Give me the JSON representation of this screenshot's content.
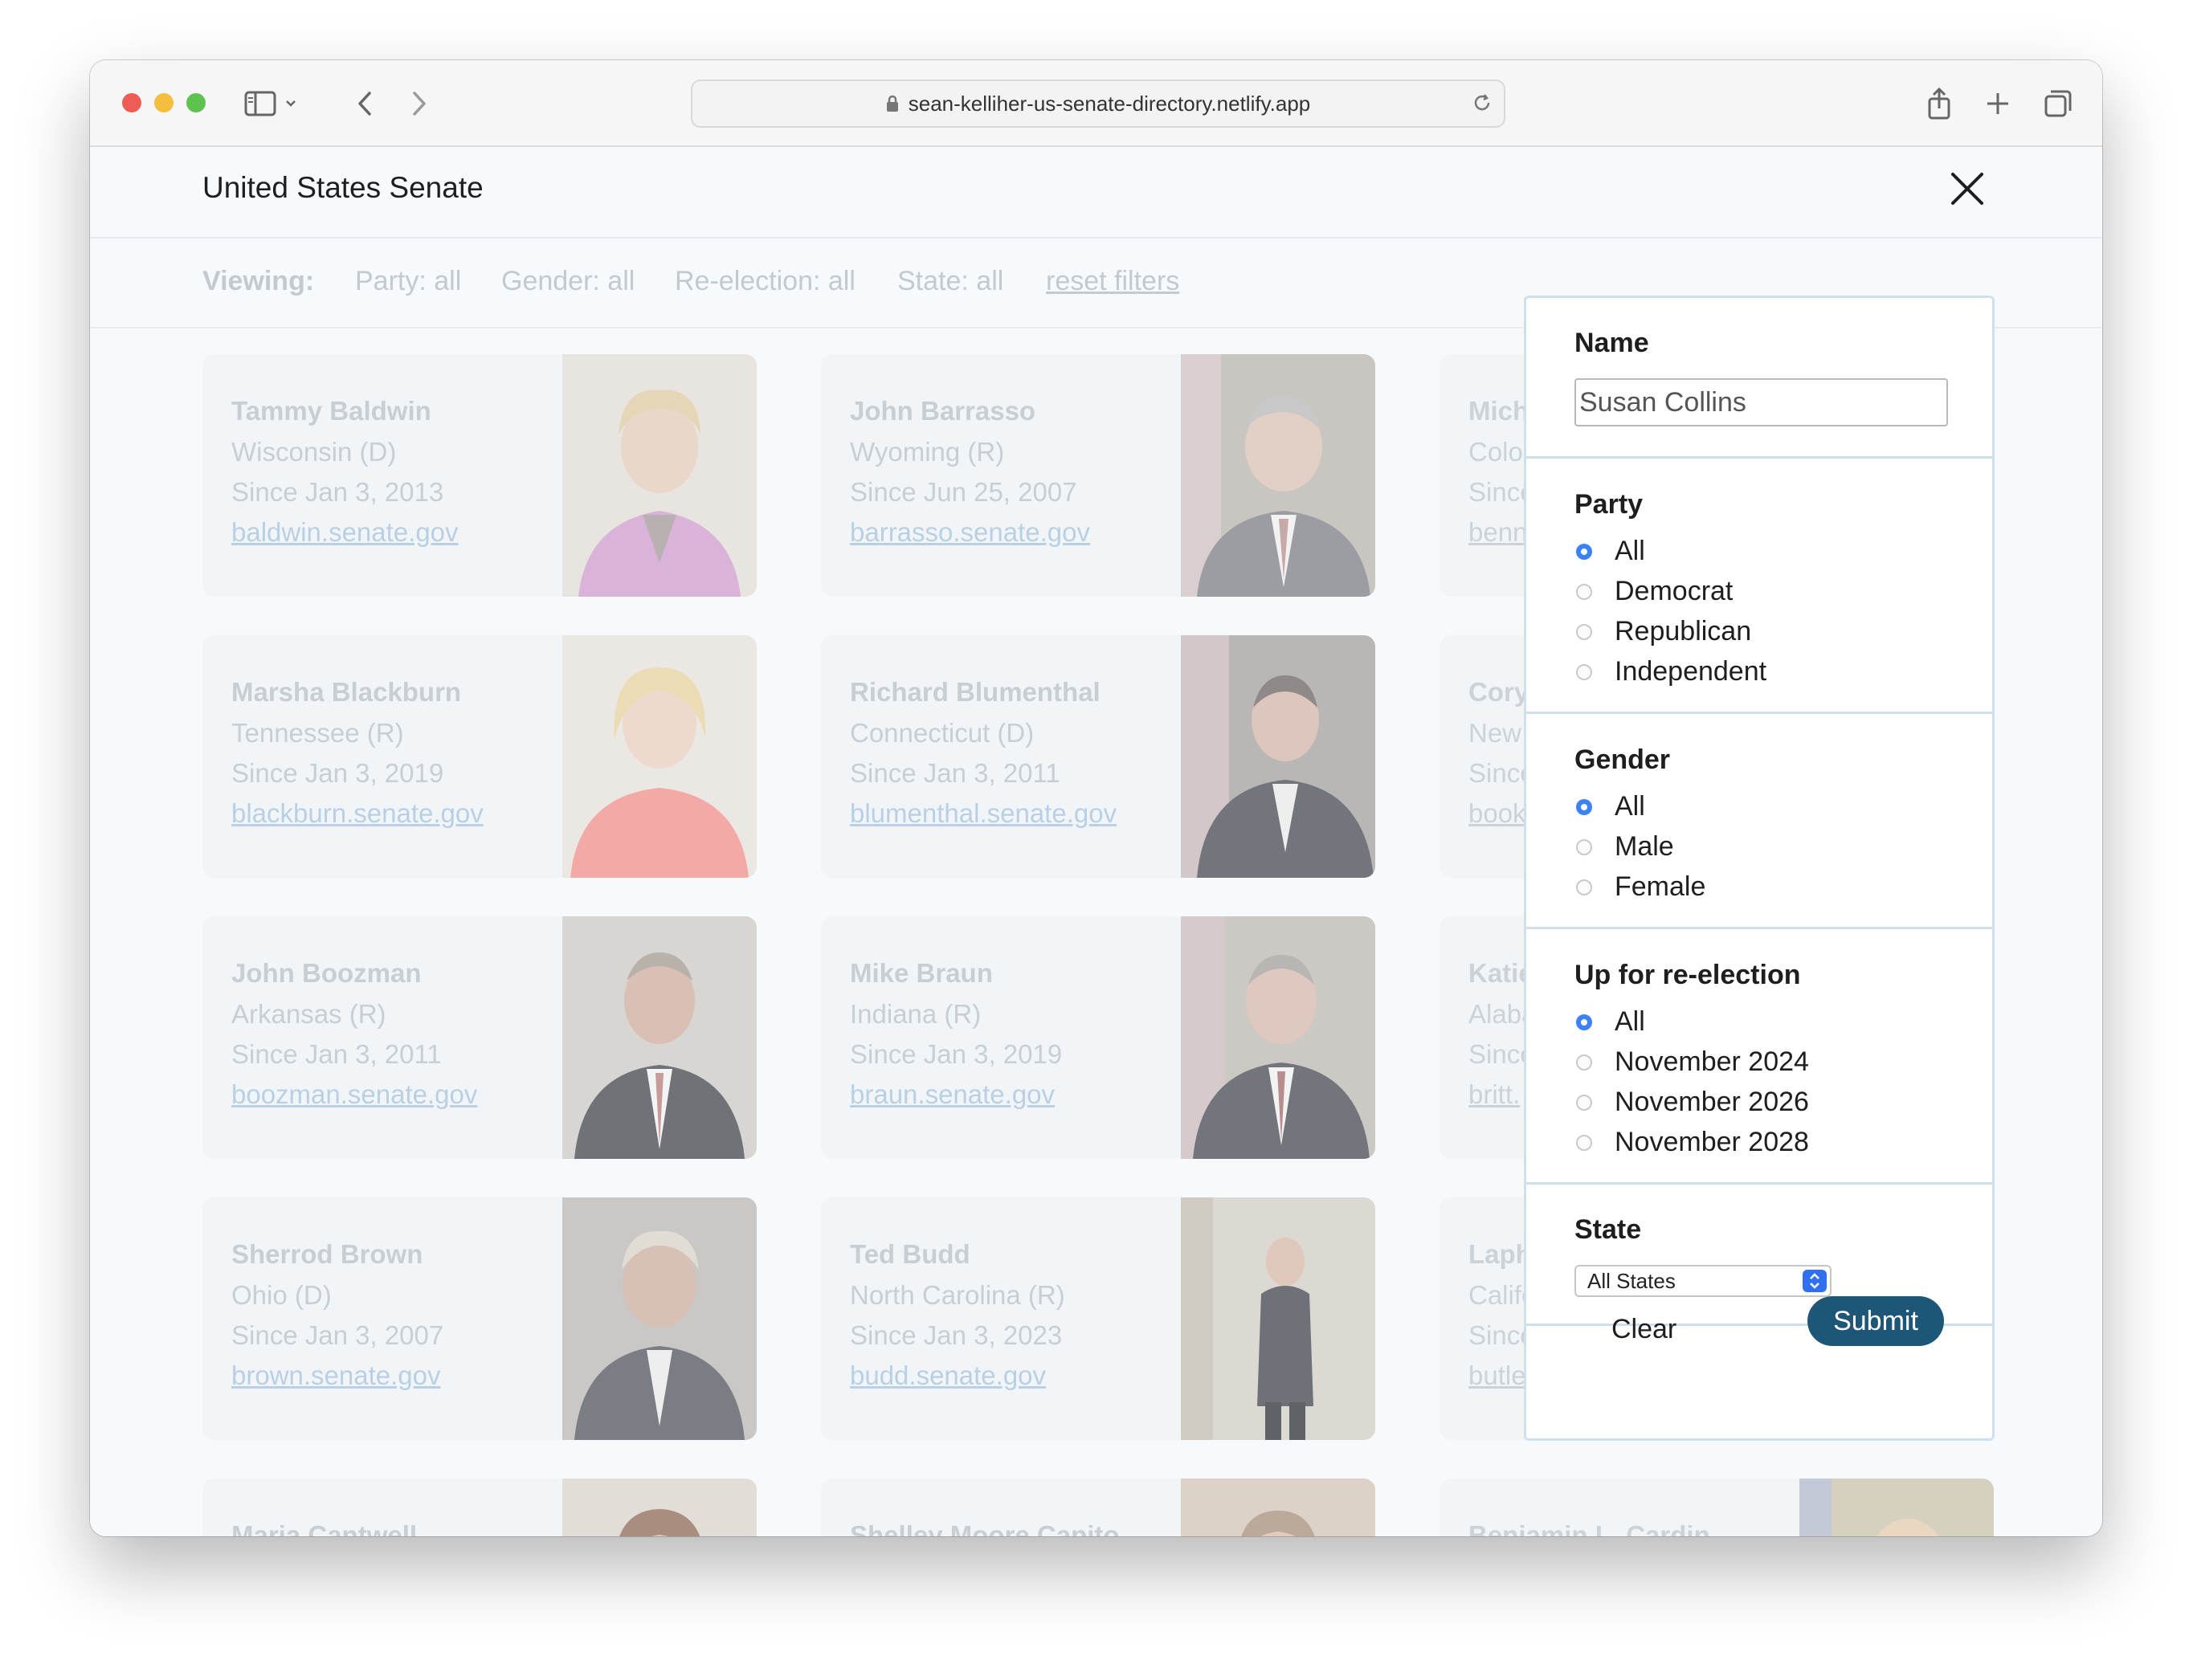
{
  "browser": {
    "url": "sean-kelliher-us-senate-directory.netlify.app"
  },
  "app": {
    "title": "United States Senate"
  },
  "filter_bar": {
    "viewing_label": "Viewing:",
    "party": "Party: all",
    "gender": "Gender: all",
    "reelection": "Re-election: all",
    "state": "State: all",
    "reset": "reset filters"
  },
  "cards": [
    {
      "name": "Tammy Baldwin",
      "state": "Wisconsin (D)",
      "since": "Since Jan 3, 2013",
      "url": "baldwin.senate.gov"
    },
    {
      "name": "John Barrasso",
      "state": "Wyoming (R)",
      "since": "Since Jun 25, 2007",
      "url": "barrasso.senate.gov"
    },
    {
      "name": "Mich",
      "state": "Colo",
      "since": "Since",
      "url": "benn"
    },
    {
      "name": "Marsha Blackburn",
      "state": "Tennessee (R)",
      "since": "Since Jan 3, 2019",
      "url": "blackburn.senate.gov"
    },
    {
      "name": "Richard Blumenthal",
      "state": "Connecticut (D)",
      "since": "Since Jan 3, 2011",
      "url": "blumenthal.senate.gov"
    },
    {
      "name": "Cory",
      "state": "New",
      "since": "Since",
      "url": "book"
    },
    {
      "name": "John Boozman",
      "state": "Arkansas (R)",
      "since": "Since Jan 3, 2011",
      "url": "boozman.senate.gov"
    },
    {
      "name": "Mike Braun",
      "state": "Indiana (R)",
      "since": "Since Jan 3, 2019",
      "url": "braun.senate.gov"
    },
    {
      "name": "Katie",
      "state": "Alaba",
      "since": "Since",
      "url": "britt."
    },
    {
      "name": "Sherrod Brown",
      "state": "Ohio (D)",
      "since": "Since Jan 3, 2007",
      "url": "brown.senate.gov"
    },
    {
      "name": "Ted Budd",
      "state": "North Carolina (R)",
      "since": "Since Jan 3, 2023",
      "url": "budd.senate.gov"
    },
    {
      "name": "Laph",
      "state": "Califo",
      "since": "Since",
      "url": "butler.senate.gov"
    },
    {
      "name": "Maria Cantwell",
      "state": "",
      "since": "",
      "url": ""
    },
    {
      "name": "Shelley Moore Capito",
      "state": "",
      "since": "",
      "url": ""
    },
    {
      "name": "Benjamin L. Cardin",
      "state": "",
      "since": "",
      "url": ""
    }
  ],
  "filter_modal": {
    "name_label": "Name",
    "name_value": "Susan Collins",
    "party_label": "Party",
    "party_options": [
      "All",
      "Democrat",
      "Republican",
      "Independent"
    ],
    "party_selected": "All",
    "gender_label": "Gender",
    "gender_options": [
      "All",
      "Male",
      "Female"
    ],
    "gender_selected": "All",
    "reelection_label": "Up for re-election",
    "reelection_options": [
      "All",
      "November 2024",
      "November 2026",
      "November 2028"
    ],
    "reelection_selected": "All",
    "state_label": "State",
    "state_selected": "All States",
    "clear_label": "Clear",
    "submit_label": "Submit"
  },
  "colors": {
    "submit": "#1e5677",
    "radio_selected": "#3b82f6",
    "modal_border": "#cfe0ea",
    "link_faded": "#b9d0e4"
  }
}
